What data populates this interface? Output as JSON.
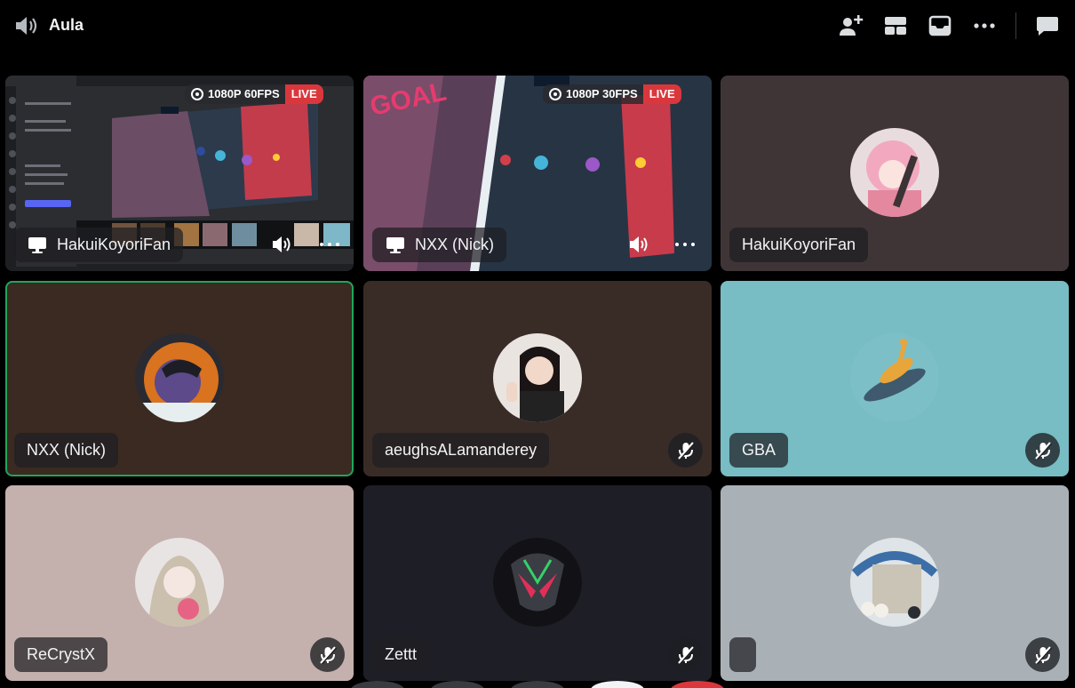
{
  "header": {
    "channel_name": "Aula",
    "icons": [
      "speaker-icon",
      "add-user-icon",
      "grid-layout-icon",
      "popout-icon",
      "more-icon",
      "chat-icon"
    ]
  },
  "tiles": [
    {
      "name": "HakuiKoyoriFan",
      "type": "stream",
      "quality": "1080P 60FPS",
      "live": "LIVE"
    },
    {
      "name": "NXX (Nick)",
      "type": "stream",
      "quality": "1080P 30FPS",
      "live": "LIVE"
    },
    {
      "name": "HakuiKoyoriFan",
      "type": "avatar",
      "background": "#3f3537"
    },
    {
      "name": "NXX (Nick)",
      "type": "avatar",
      "background": "#3b2a21",
      "speaking": true
    },
    {
      "name": "aeughsALamanderey",
      "type": "avatar",
      "background": "#392c27",
      "muted": true
    },
    {
      "name": "GBA",
      "type": "avatar",
      "background": "#78bcc4",
      "muted": true
    },
    {
      "name": "ReCrystX",
      "type": "avatar",
      "background": "#c4b0ac",
      "muted": true
    },
    {
      "name": "Zettt",
      "type": "avatar",
      "background": "#1e1e26",
      "muted": true
    },
    {
      "name": "",
      "type": "avatar",
      "background": "#a9b1b7",
      "muted": true
    }
  ],
  "colors": {
    "speaking_border": "#23a55a",
    "live_badge": "#da373c"
  }
}
